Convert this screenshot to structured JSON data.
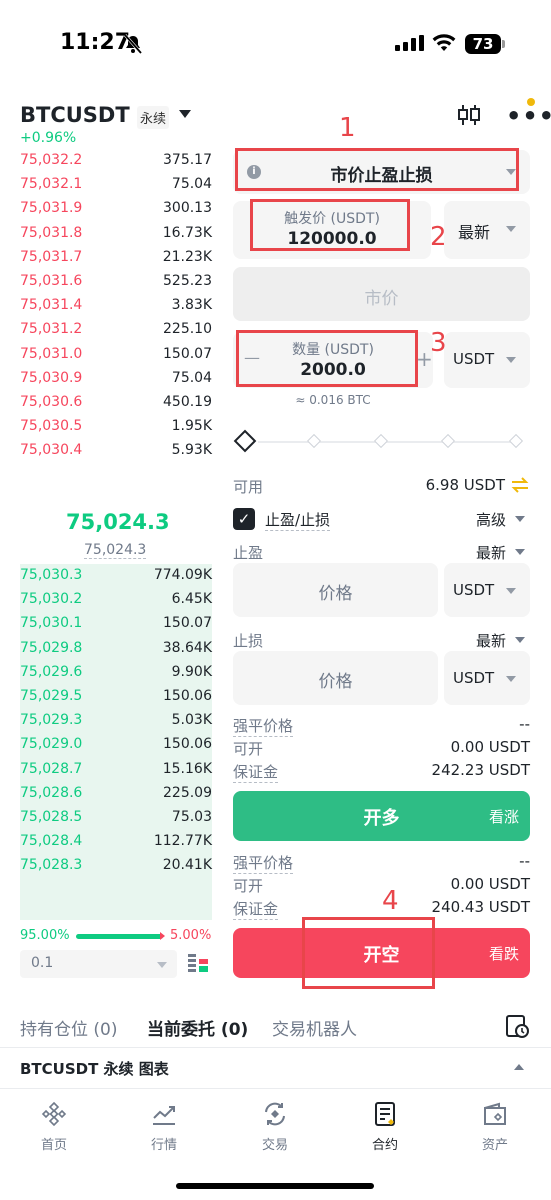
{
  "status_bar": {
    "time": "11:27",
    "battery": "73"
  },
  "header": {
    "symbol": "BTCUSDT",
    "contract_type": "永续",
    "change": "+0.96%"
  },
  "orderbook": {
    "asks": [
      {
        "price": "75,032.2",
        "qty": "375.17"
      },
      {
        "price": "75,032.1",
        "qty": "75.04"
      },
      {
        "price": "75,031.9",
        "qty": "300.13"
      },
      {
        "price": "75,031.8",
        "qty": "16.73K"
      },
      {
        "price": "75,031.7",
        "qty": "21.23K"
      },
      {
        "price": "75,031.6",
        "qty": "525.23"
      },
      {
        "price": "75,031.4",
        "qty": "3.83K"
      },
      {
        "price": "75,031.2",
        "qty": "225.10"
      },
      {
        "price": "75,031.0",
        "qty": "150.07"
      },
      {
        "price": "75,030.9",
        "qty": "75.04"
      },
      {
        "price": "75,030.6",
        "qty": "450.19"
      },
      {
        "price": "75,030.5",
        "qty": "1.95K"
      },
      {
        "price": "75,030.4",
        "qty": "5.93K"
      }
    ],
    "last_price": "75,024.3",
    "mark_price": "75,024.3",
    "bids": [
      {
        "price": "75,030.3",
        "qty": "774.09K"
      },
      {
        "price": "75,030.2",
        "qty": "6.45K"
      },
      {
        "price": "75,030.1",
        "qty": "150.07"
      },
      {
        "price": "75,029.8",
        "qty": "38.64K"
      },
      {
        "price": "75,029.6",
        "qty": "9.90K"
      },
      {
        "price": "75,029.5",
        "qty": "150.06"
      },
      {
        "price": "75,029.3",
        "qty": "5.03K"
      },
      {
        "price": "75,029.0",
        "qty": "150.06"
      },
      {
        "price": "75,028.7",
        "qty": "15.16K"
      },
      {
        "price": "75,028.6",
        "qty": "225.09"
      },
      {
        "price": "75,028.5",
        "qty": "75.03"
      },
      {
        "price": "75,028.4",
        "qty": "112.77K"
      },
      {
        "price": "75,028.3",
        "qty": "20.41K"
      }
    ],
    "buy_ratio": "95.00%",
    "sell_ratio": "5.00%",
    "buy_ratio_value": 0.95,
    "precision": "0.1"
  },
  "order_form": {
    "order_type": "市价止盈止损",
    "trigger_label": "触发价 (USDT)",
    "trigger_value": "120000.0",
    "trigger_source": "最新",
    "price_placeholder": "市价",
    "qty_label": "数量 (USDT)",
    "qty_value": "2000.0",
    "qty_unit": "USDT",
    "qty_minus": "—",
    "qty_plus": "+",
    "approx": "≈ 0.016 BTC",
    "available_label": "可用",
    "available_value": "6.98 USDT",
    "tpsl_label": "止盈/止损",
    "advanced": "高级",
    "tp_label": "止盈",
    "tp_source": "最新",
    "tp_placeholder": "价格",
    "tp_unit": "USDT",
    "sl_label": "止损",
    "sl_source": "最新",
    "sl_placeholder": "价格",
    "sl_unit": "USDT",
    "long_info": {
      "liq_label": "强平价格",
      "liq_value": "--",
      "open_label": "可开",
      "open_value": "0.00 USDT",
      "margin_label": "保证金",
      "margin_value": "242.23 USDT"
    },
    "long_button": "开多",
    "long_sub": "看涨",
    "short_info": {
      "liq_label": "强平价格",
      "liq_value": "--",
      "open_label": "可开",
      "open_value": "0.00 USDT",
      "margin_label": "保证金",
      "margin_value": "240.43 USDT"
    },
    "short_button": "开空",
    "short_sub": "看跌"
  },
  "annotations": [
    "1",
    "2",
    "3",
    "4"
  ],
  "bottom_tabs": [
    {
      "label": "持有仓位 (0)"
    },
    {
      "label": "当前委托 (0)"
    },
    {
      "label": "交易机器人"
    }
  ],
  "chart_bar": {
    "label": "BTCUSDT 永续 图表"
  },
  "nav": [
    {
      "label": "首页",
      "icon": "home-icon"
    },
    {
      "label": "行情",
      "icon": "markets-icon"
    },
    {
      "label": "交易",
      "icon": "trade-icon"
    },
    {
      "label": "合约",
      "icon": "futures-icon"
    },
    {
      "label": "资产",
      "icon": "wallet-icon"
    }
  ],
  "colors": {
    "up": "#0ecb81",
    "down": "#f6465d",
    "accent": "#f0b90b",
    "annotation": "#e8454a"
  }
}
